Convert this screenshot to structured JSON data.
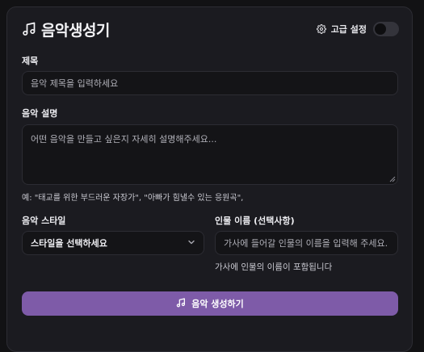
{
  "header": {
    "title": "음악생성기",
    "title_icon": "music-note-icon",
    "advanced_label": "고급 설정",
    "advanced_icon": "gear-icon",
    "advanced_enabled": false
  },
  "form": {
    "title_label": "제목",
    "title_placeholder": "음악 제목을 입력하세요",
    "description_label": "음악 설명",
    "description_placeholder": "어떤 음악을 만들고 싶은지 자세히 설명해주세요...",
    "description_hint": "예: \"태교를 위한 부드러운 자장가\", \"아빠가 힘낼수 있는 응원곡\",",
    "style_label": "음악 스타일",
    "style_value": "스타일을 선택하세요",
    "name_label": "인물 이름 (선택사항)",
    "name_placeholder": "가사에 들어갈 인물의 이름을 입력해 주세요.",
    "name_hint": "가사에 인물의 이름이 포함됩니다",
    "generate_label": "음악 생성하기",
    "generate_icon": "music-note-icon"
  },
  "colors": {
    "accent": "#7e5ba8",
    "background": "#1b1b20"
  }
}
